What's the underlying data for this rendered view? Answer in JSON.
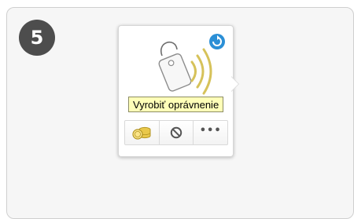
{
  "step": {
    "number": "5"
  },
  "card": {
    "hero_icon": "tag-nfc-icon",
    "refresh_icon": "refresh-icon",
    "tooltip": "Vyrobiť oprávnenie",
    "actions": [
      {
        "icon": "coins-icon"
      },
      {
        "icon": "block-icon"
      },
      {
        "icon": "more-icon",
        "label": "•••"
      }
    ]
  },
  "colors": {
    "badge": "#4d4d4d",
    "tooltip_bg": "#ffffb8",
    "accent_blue": "#2b8fd6",
    "accent_gold": "#d6c25a"
  }
}
